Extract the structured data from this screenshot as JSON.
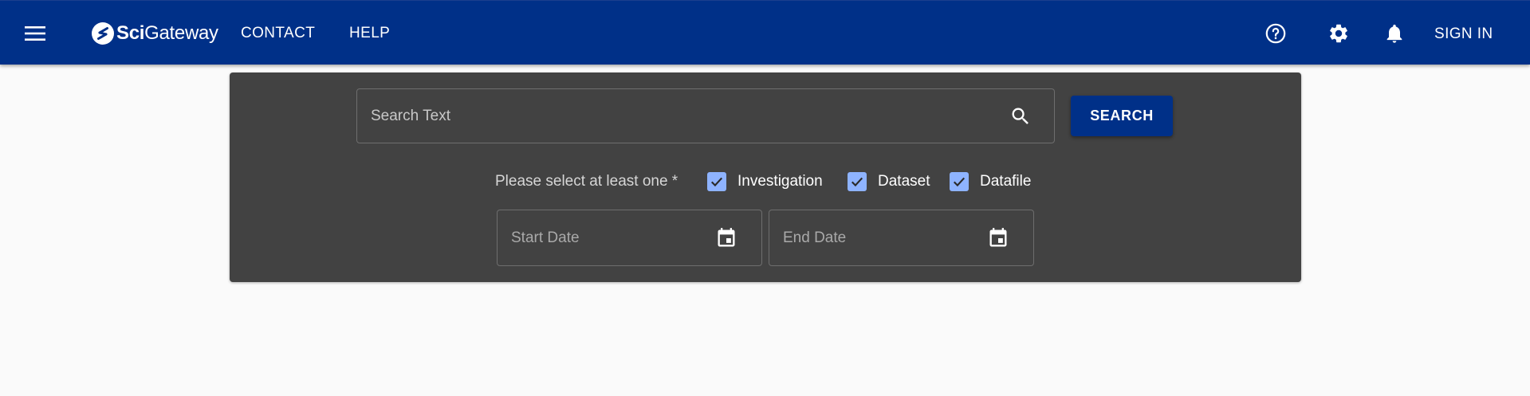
{
  "header": {
    "logo": {
      "bold": "Sci",
      "regular": "Gateway"
    },
    "nav": {
      "contact": "CONTACT",
      "help": "HELP"
    },
    "icons": {
      "menu": "menu-icon",
      "help": "help-circle-icon",
      "settings": "gear-icon",
      "notifications": "bell-icon"
    },
    "sign_in": "SIGN IN",
    "background": "#003088"
  },
  "search": {
    "text_placeholder": "Search Text",
    "button_label": "SEARCH",
    "select_label": "Please select at least one *",
    "options": [
      {
        "label": "Investigation",
        "checked": true
      },
      {
        "label": "Dataset",
        "checked": true
      },
      {
        "label": "Datafile",
        "checked": true
      }
    ],
    "start_date_placeholder": "Start Date",
    "end_date_placeholder": "End Date",
    "panel_background": "#424242",
    "checkbox_color": "#8eb3ff"
  }
}
